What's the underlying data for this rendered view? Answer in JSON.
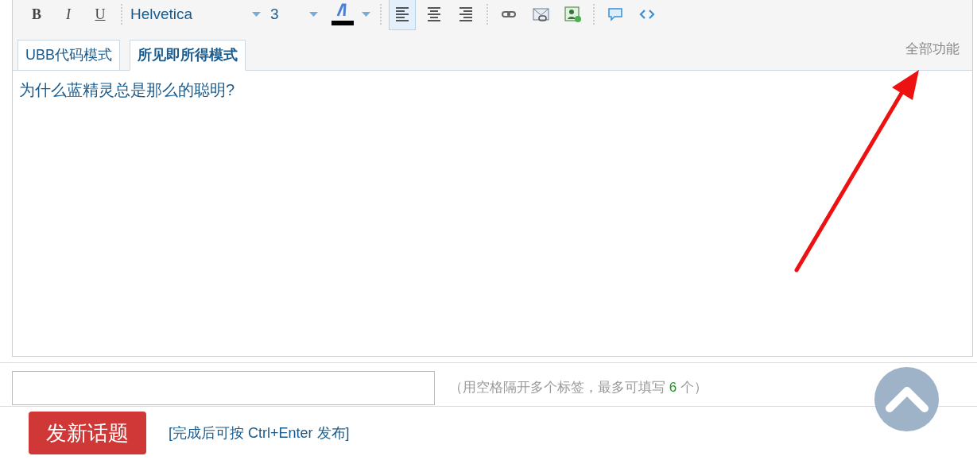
{
  "toolbar": [
    {
      "kind": "bold",
      "label": "B"
    },
    {
      "kind": "italic",
      "label": "I"
    },
    {
      "kind": "underline",
      "label": "U"
    },
    {
      "kind": "sep"
    },
    {
      "kind": "select",
      "label": "Helvetica"
    },
    {
      "kind": "select",
      "label": "3"
    },
    {
      "kind": "color",
      "color": "#000000"
    },
    {
      "kind": "sep"
    },
    {
      "kind": "align-left",
      "selected": true
    },
    {
      "kind": "align-center",
      "selected": false
    },
    {
      "kind": "align-right",
      "selected": false
    },
    {
      "kind": "sep"
    },
    {
      "kind": "link"
    },
    {
      "kind": "email"
    },
    {
      "kind": "image"
    },
    {
      "kind": "sep"
    },
    {
      "kind": "quote"
    },
    {
      "kind": "code"
    }
  ],
  "tabs": [
    {
      "label": "UBB代码模式",
      "selected": false
    },
    {
      "label": "所见即所得模式",
      "selected": true
    }
  ],
  "all_features": "全部功能",
  "content": "为什么蓝精灵总是那么的聪明?",
  "tags": {
    "hint_before": "（用空格隔开多个标签，最多可填写 ",
    "max": "6",
    "hint_after": " 个）"
  },
  "submit": {
    "label": "发新话题",
    "hint": "[完成后可按 Ctrl+Enter 发布]"
  }
}
